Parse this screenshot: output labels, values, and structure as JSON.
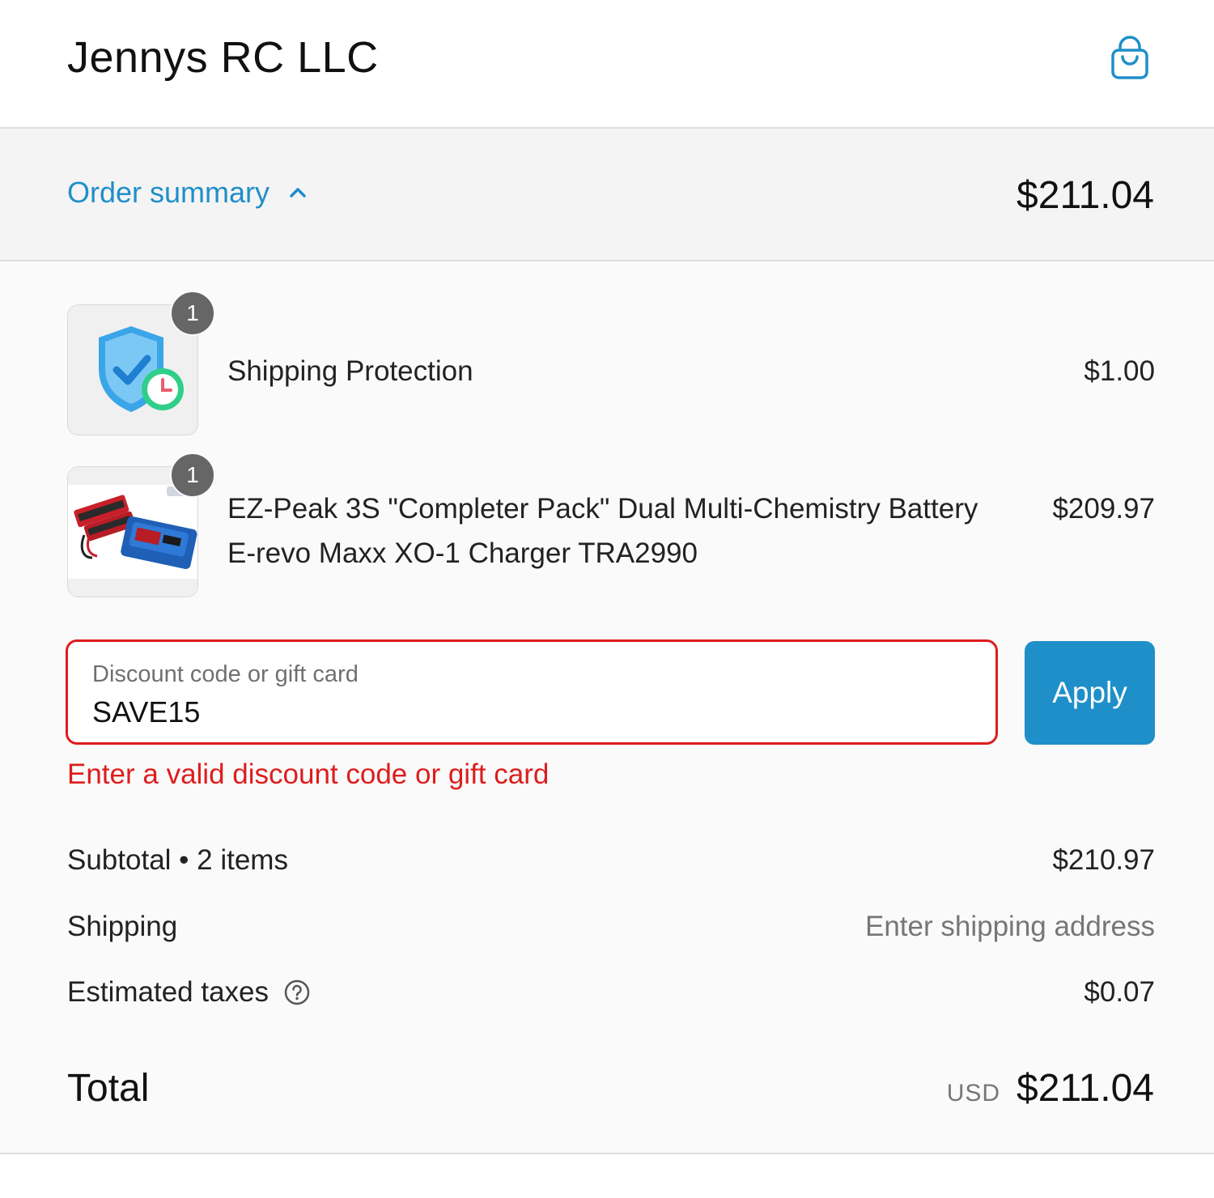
{
  "header": {
    "store_name": "Jennys RC LLC",
    "cart_icon": "shopping-bag-icon"
  },
  "summary_bar": {
    "toggle_label": "Order summary",
    "toggle_icon": "chevron-up-icon",
    "total": "$211.04"
  },
  "line_items": [
    {
      "quantity": "1",
      "name": "Shipping Protection",
      "price": "$1.00",
      "image": "shield-check-clock-icon"
    },
    {
      "quantity": "1",
      "name_line1": "EZ-Peak 3S \"Completer Pack\" Dual Multi-Chemistry Battery",
      "name_line2": "E-revo Maxx XO-1 Charger TRA2990",
      "price": "$209.97",
      "image": "battery-charger-product-image"
    }
  ],
  "discount": {
    "label": "Discount code or gift card",
    "value": "SAVE15",
    "apply_label": "Apply",
    "error": "Enter a valid discount code or gift card"
  },
  "costs": {
    "subtotal_label": "Subtotal • 2 items",
    "subtotal_value": "$210.97",
    "shipping_label": "Shipping",
    "shipping_value": "Enter shipping address",
    "taxes_label": "Estimated taxes",
    "taxes_value": "$0.07",
    "taxes_icon": "question-circle-icon"
  },
  "total": {
    "label": "Total",
    "currency": "USD",
    "amount": "$211.04"
  },
  "colors": {
    "accent": "#1f8fc9",
    "error": "#dd1d1d",
    "muted": "#767676"
  }
}
